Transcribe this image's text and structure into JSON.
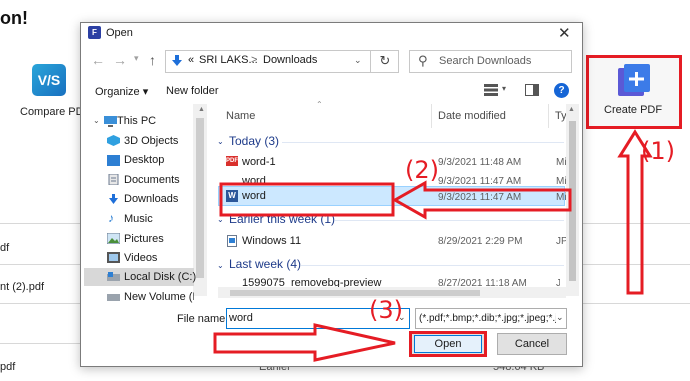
{
  "background_app": {
    "title": "on!",
    "tool_compare_label": "Compare PDF",
    "tool_icon_text": "V/S",
    "rows": [
      "df",
      "nt (2).pdf",
      "pdf"
    ],
    "row_bottom_meta": [
      "Earlier",
      "548.64 KB"
    ],
    "create_pdf_label": "Create PDF"
  },
  "dialog": {
    "title": "Open",
    "title_icon_text": "F",
    "address": {
      "prefix": "«",
      "segment1": "SRI LAKS...",
      "separator": ">",
      "segment2": "Downloads"
    },
    "search_placeholder": "Search Downloads",
    "toolbar": {
      "organize": "Organize ▾",
      "new_folder": "New folder"
    },
    "nav": [
      {
        "label": "This PC",
        "icon": "pc-icon"
      },
      {
        "label": "3D Objects",
        "icon": "3d-objects-icon"
      },
      {
        "label": "Desktop",
        "icon": "desktop-icon"
      },
      {
        "label": "Documents",
        "icon": "documents-icon"
      },
      {
        "label": "Downloads",
        "icon": "downloads-icon"
      },
      {
        "label": "Music",
        "icon": "music-icon"
      },
      {
        "label": "Pictures",
        "icon": "pictures-icon"
      },
      {
        "label": "Videos",
        "icon": "videos-icon"
      },
      {
        "label": "Local Disk (C:)",
        "icon": "disk-icon"
      },
      {
        "label": "New Volume (D:",
        "icon": "disk-icon"
      }
    ],
    "columns": {
      "name": "Name",
      "date": "Date modified",
      "type": "Typ"
    },
    "groups": {
      "today": "Today (3)",
      "earlier_week": "Earlier this week (1)",
      "last_week": "Last week (4)"
    },
    "files": [
      {
        "name": "word-1",
        "date": "9/3/2021 11:48 AM",
        "type": "Mi"
      },
      {
        "name": "word",
        "date": "9/3/2021 11:47 AM",
        "type": "Mi"
      },
      {
        "name": "word",
        "date": "9/3/2021 11:47 AM",
        "type": "Mi"
      },
      {
        "name": "Windows 11",
        "date": "8/29/2021 2:29 PM",
        "type": "JPG"
      },
      {
        "name": "1599075_removebg-preview",
        "date": "8/27/2021 11:18 AM",
        "type": "JPG"
      }
    ],
    "filename_label": "File name:",
    "filename_value": "word",
    "filter_value": "(*.pdf;*.bmp;*.dib;*.jpg;*.jpeg;*.j",
    "open_button": "Open",
    "cancel_button": "Cancel"
  },
  "annotations": {
    "step1": "(1)",
    "step2": "(2)",
    "step3": "(3)",
    "color": "#e51c24"
  }
}
